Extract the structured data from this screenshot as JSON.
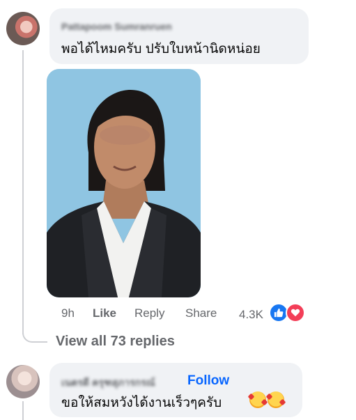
{
  "comment1": {
    "author": "Pattapoom Sumranruen",
    "text": "พอได้ไหมครับ ปรับใบหน้านิดหน่อย",
    "actions": {
      "time": "9h",
      "like": "Like",
      "reply": "Reply",
      "share": "Share"
    },
    "reaction_count": "4.3K",
    "reactions": [
      "like-reaction-icon",
      "love-reaction-icon"
    ],
    "view_replies": "View all 73 replies"
  },
  "comment2": {
    "author": "เนตรดี ครุฑสุภารกรณ์",
    "follow": "Follow",
    "text": "ขอให้สมหวังได้งานเร็วๆครับ"
  },
  "colors": {
    "bubble": "#f0f2f5",
    "secondary_text": "#65676b",
    "link_blue": "#0866ff",
    "like_blue": "#1877f2",
    "love_red": "#f33e58"
  }
}
